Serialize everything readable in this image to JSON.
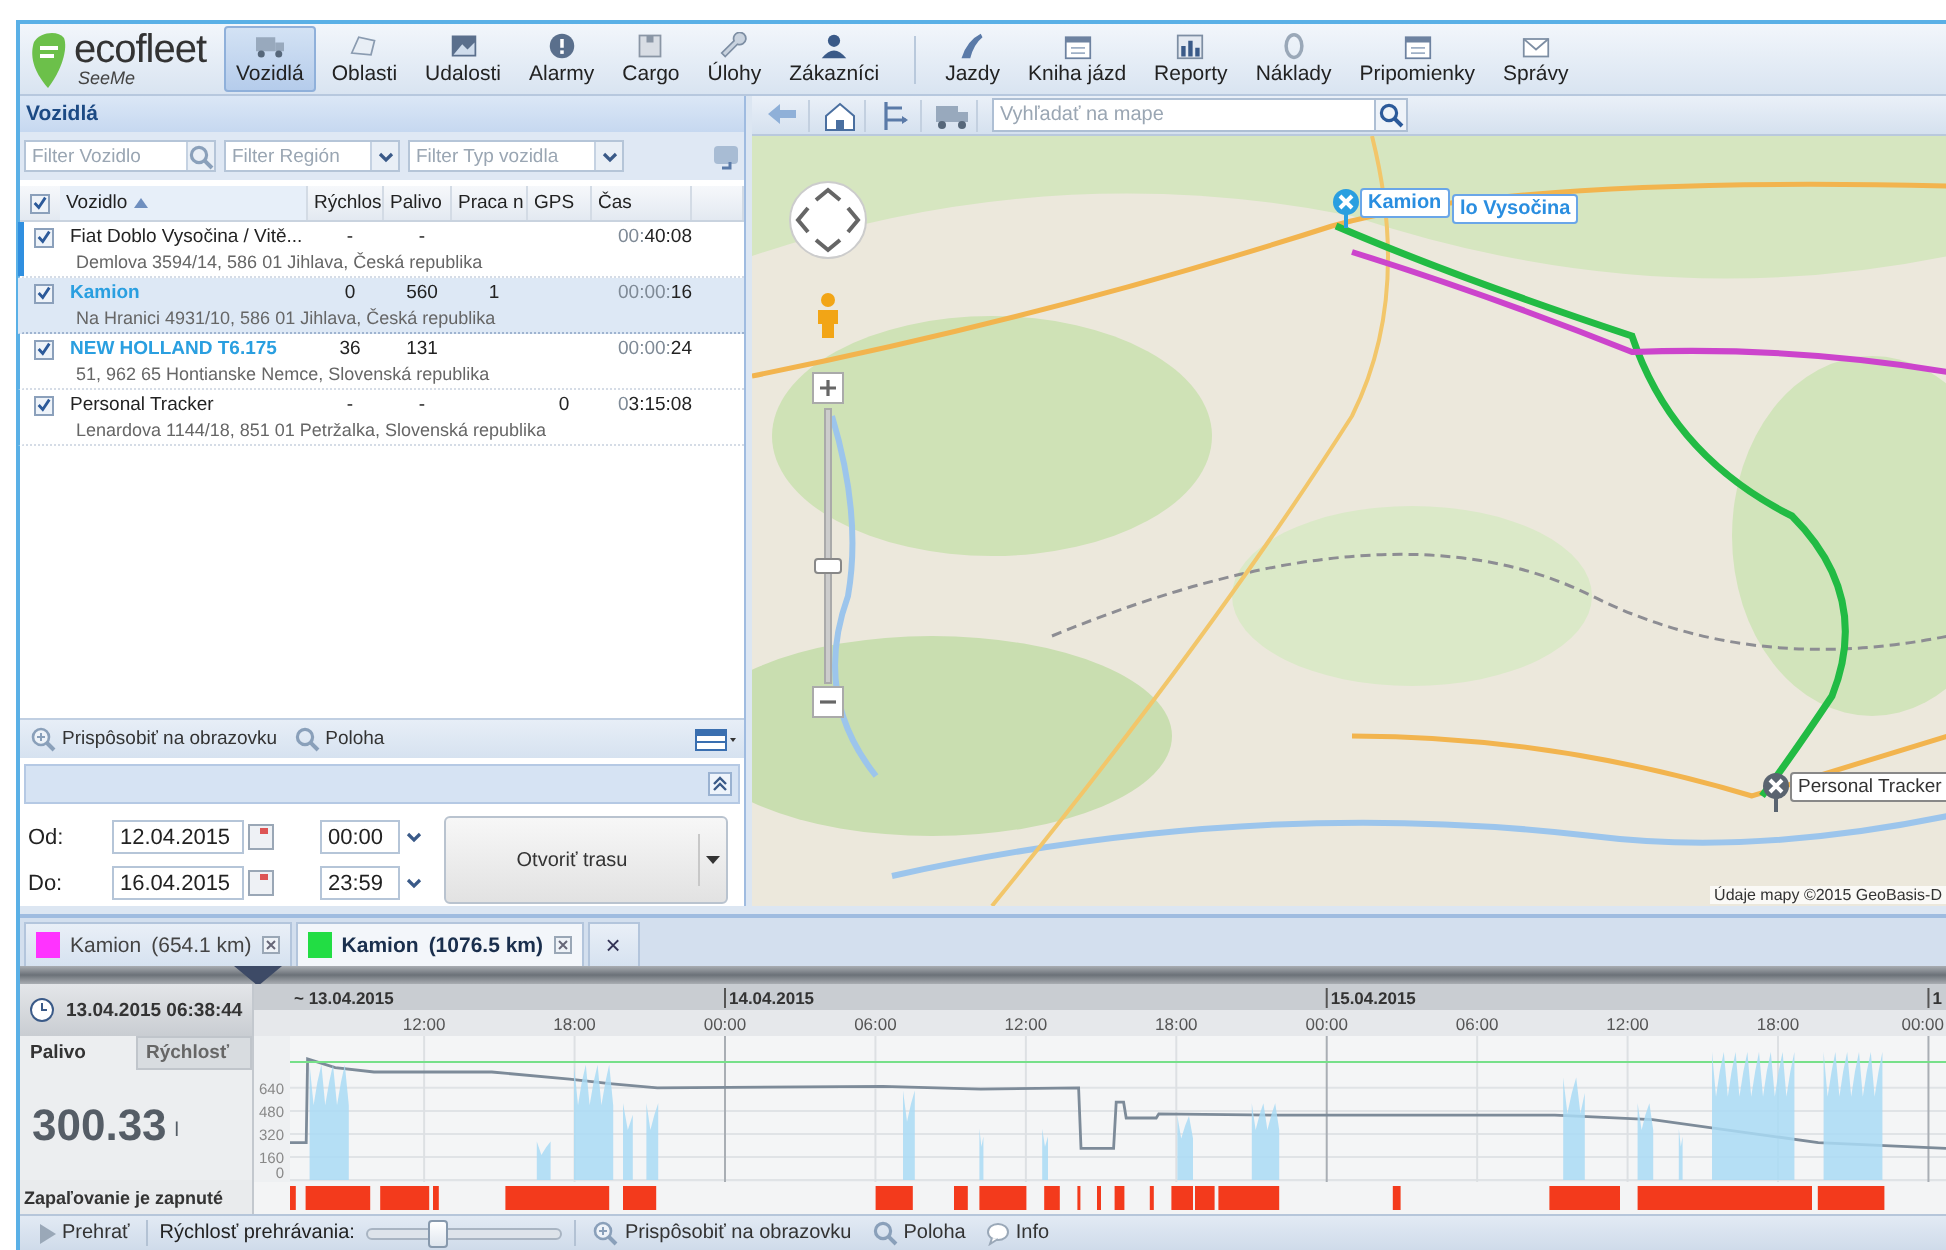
{
  "logo": {
    "name": "ecofleet",
    "tagline": "SeeMe"
  },
  "toolbar": {
    "groups": [
      [
        {
          "label": "Vozidlá",
          "selected": true
        },
        {
          "label": "Oblasti",
          "selected": false
        },
        {
          "label": "Udalosti",
          "selected": false
        },
        {
          "label": "Alarmy",
          "selected": false
        },
        {
          "label": "Cargo",
          "selected": false
        },
        {
          "label": "Úlohy",
          "selected": false
        },
        {
          "label": "Zákazníci",
          "selected": false
        }
      ],
      [
        {
          "label": "Jazdy",
          "selected": false
        },
        {
          "label": "Kniha jázd",
          "selected": false
        },
        {
          "label": "Reporty",
          "selected": false
        },
        {
          "label": "Náklady",
          "selected": false
        },
        {
          "label": "Pripomienky",
          "selected": false
        },
        {
          "label": "Správy",
          "selected": false
        }
      ]
    ]
  },
  "vehicles": {
    "title": "Vozidlá",
    "filters": [
      {
        "kind": "search",
        "placeholder": "Filter Vozidlo"
      },
      {
        "kind": "select",
        "placeholder": "Filter Región"
      },
      {
        "kind": "select",
        "placeholder": "Filter Typ vozidla"
      }
    ],
    "all_checked": true,
    "columns": [
      {
        "label": "Vozidlo",
        "sorted": true
      },
      {
        "label": "Rýchlos",
        "sorted": false
      },
      {
        "label": "Palivo",
        "sorted": false
      },
      {
        "label": "Praca n",
        "sorted": false
      },
      {
        "label": "GPS",
        "sorted": false
      },
      {
        "label": "Čas",
        "sorted": false
      }
    ],
    "rows": [
      {
        "name": "Fiat Doblo Vysočina / Vitě...",
        "color": "#222222",
        "checked": true,
        "selected": false,
        "focused": true,
        "speed": "-",
        "fuel": "-",
        "time_prefix": "00:",
        "time": "40:08",
        "address": "Demlova 3594/14, 586 01 Jihlava, Česká republika"
      },
      {
        "name": "Kamion",
        "color": "#2a9fe0",
        "checked": true,
        "selected": true,
        "focused": false,
        "speed": "0",
        "fuel": "560",
        "work": "1",
        "time_prefix": "00:00:",
        "time": "16",
        "address": "Na Hranici 4931/10, 586 01 Jihlava, Česká republika"
      },
      {
        "name": "NEW HOLLAND T6.175",
        "color": "#2a9fe0",
        "checked": true,
        "selected": false,
        "focused": false,
        "speed": "36",
        "fuel": "131",
        "time_prefix": "00:00:",
        "time": "24",
        "address": "51, 962 65 Hontianske Nemce, Slovenská republika"
      },
      {
        "name": "Personal Tracker",
        "color": "#222222",
        "checked": true,
        "selected": false,
        "focused": false,
        "speed": "-",
        "fuel": "-",
        "gps": "0",
        "time_prefix": "0",
        "time": "3:15:08",
        "address": "Lenardova 1144/18, 851 01 Petržalka, Slovenská republika"
      }
    ],
    "footer": {
      "fit": "Prispôsobiť na obrazovku",
      "locate": "Poloha"
    },
    "range": {
      "from_label": "Od:",
      "from_date": "12.04.2015",
      "from_time": "00:00",
      "to_label": "Do:",
      "to_date": "16.04.2015",
      "to_time": "23:59",
      "button": "Otvoriť trasu"
    }
  },
  "map": {
    "search_placeholder": "Vyhľadať na mape",
    "zoom": {
      "level": 0.42
    },
    "markers": [
      {
        "label": "Kamion"
      },
      {
        "label": "lo Vysočina"
      },
      {
        "label": "Personal Tracker"
      }
    ],
    "attribution": "Údaje mapy ©2015 GeoBasis-D"
  },
  "route_tabs": [
    {
      "label": "Kamion",
      "distance": "(654.1 km)",
      "color": "#ff33ff",
      "selected": false
    },
    {
      "label": "Kamion",
      "distance": "(1076.5 km)",
      "color": "#22dd44",
      "selected": true
    }
  ],
  "close_all": "×",
  "timeline": {
    "cursor_time": "13.04.2015 06:38:44",
    "tabs": [
      {
        "label": "Palivo",
        "selected": true
      },
      {
        "label": "Rýchlosť",
        "selected": false
      }
    ],
    "value": "300.33",
    "unit": "l",
    "dates": [
      "~ 13.04.2015",
      "14.04.2015",
      "15.04.2015",
      "1"
    ],
    "ignition_label": "Zapaľovanie je zapnuté",
    "chart_data": {
      "type": "line",
      "x": [
        "2015-04-13 06:39",
        "2015-04-13 07:18",
        "2015-04-13 07:21",
        "2015-04-13 08:27",
        "2015-04-13 10:00",
        "2015-04-13 14:42",
        "2015-04-13 17:48",
        "2015-04-13 19:24",
        "2015-04-13 21:18",
        "2015-04-14 06:18",
        "2015-04-14 10:12",
        "2015-04-14 14:06",
        "2015-04-14 14:12",
        "2015-04-14 15:30",
        "2015-04-14 15:36",
        "2015-04-14 15:54",
        "2015-04-14 16:00",
        "2015-04-14 17:12",
        "2015-04-14 17:18",
        "2015-04-14 22:00",
        "2015-04-15 09:06",
        "2015-04-15 13:00",
        "2015-04-15 19:36",
        "2015-04-16 00:42"
      ],
      "series": [
        {
          "color": "#7d8b99",
          "values": [
            260,
            260,
            840,
            780,
            750,
            750,
            700,
            670,
            640,
            650,
            630,
            640,
            220,
            220,
            540,
            540,
            430,
            430,
            460,
            450,
            450,
            420,
            260,
            220
          ]
        },
        {
          "color": "#77e08a",
          "values": [
            820,
            820,
            820,
            820,
            820,
            820,
            820,
            820,
            820,
            820,
            820,
            820,
            820,
            820,
            820,
            820,
            820,
            820,
            820,
            820,
            820,
            820,
            820,
            820
          ]
        }
      ],
      "xlim": [
        "2015-04-13 06:39",
        "2015-04-16 00:42"
      ],
      "ylim": [
        0,
        1000
      ],
      "grid": true,
      "xticks": [
        {
          "value": "2015-04-13 12:00",
          "label": "12:00"
        },
        {
          "value": "2015-04-13 18:00",
          "label": "18:00"
        },
        {
          "value": "2015-04-14 00:00",
          "label": "00:00"
        },
        {
          "value": "2015-04-14 06:00",
          "label": "06:00"
        },
        {
          "value": "2015-04-14 12:00",
          "label": "12:00"
        },
        {
          "value": "2015-04-14 18:00",
          "label": "18:00"
        },
        {
          "value": "2015-04-15 00:00",
          "label": "00:00"
        },
        {
          "value": "2015-04-15 06:00",
          "label": "06:00"
        },
        {
          "value": "2015-04-15 12:00",
          "label": "12:00"
        },
        {
          "value": "2015-04-15 18:00",
          "label": "18:00"
        },
        {
          "value": "2015-04-16 00:00",
          "label": "00:00"
        }
      ],
      "yticks": [
        0,
        160,
        320,
        480,
        640
      ]
    }
  },
  "player": {
    "play": "Prehrať",
    "speed_label": "Rýchlosť prehrávania:",
    "speed": {
      "level": 0.36
    },
    "fit": "Prispôsobiť na obrazovku",
    "locate": "Poloha",
    "info": "Info"
  }
}
